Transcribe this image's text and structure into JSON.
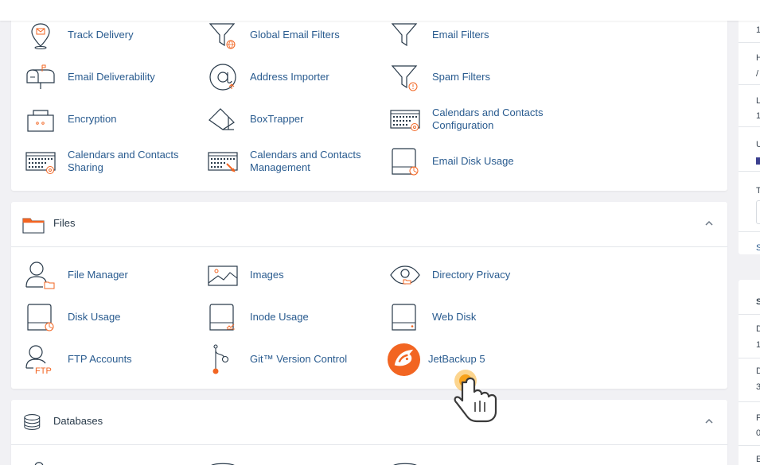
{
  "email_section": {
    "items": [
      {
        "label": "Track Delivery",
        "icon": "track-delivery-icon"
      },
      {
        "label": "Global Email Filters",
        "icon": "global-email-filters-icon"
      },
      {
        "label": "Email Filters",
        "icon": "email-filters-icon"
      },
      {
        "label": "Email Deliverability",
        "icon": "email-deliverability-icon"
      },
      {
        "label": "Address Importer",
        "icon": "address-importer-icon"
      },
      {
        "label": "Spam Filters",
        "icon": "spam-filters-icon"
      },
      {
        "label": "Encryption",
        "icon": "encryption-icon"
      },
      {
        "label": "BoxTrapper",
        "icon": "boxtrapper-icon"
      },
      {
        "label": "Calendars and Contacts Configuration",
        "icon": "calendar-config-icon"
      },
      {
        "label": "Calendars and Contacts Sharing",
        "icon": "calendar-sharing-icon"
      },
      {
        "label": "Calendars and Contacts Management",
        "icon": "calendar-management-icon"
      },
      {
        "label": "Email Disk Usage",
        "icon": "email-disk-usage-icon"
      }
    ]
  },
  "files_section": {
    "title": "Files",
    "items": [
      {
        "label": "File Manager",
        "icon": "file-manager-icon"
      },
      {
        "label": "Images",
        "icon": "images-icon"
      },
      {
        "label": "Directory Privacy",
        "icon": "directory-privacy-icon"
      },
      {
        "label": "Disk Usage",
        "icon": "disk-usage-icon"
      },
      {
        "label": "Inode Usage",
        "icon": "inode-usage-icon"
      },
      {
        "label": "Web Disk",
        "icon": "web-disk-icon"
      },
      {
        "label": "FTP Accounts",
        "icon": "ftp-accounts-icon"
      },
      {
        "label": "Git™ Version Control",
        "icon": "git-icon"
      },
      {
        "label": "JetBackup 5",
        "icon": "jetbackup-icon"
      }
    ],
    "ftp_badge": "FTP"
  },
  "databases_section": {
    "title": "Databases"
  },
  "right_column": {
    "c1_rows": [
      "1",
      "H",
      "/",
      "L",
      "1",
      "U",
      "T",
      "S"
    ],
    "c2_rows": [
      "S",
      "D",
      "1",
      "D",
      "3",
      "F",
      "0",
      "E"
    ]
  },
  "colors": {
    "accent": "#f26522",
    "link": "#295b8f",
    "icon_stroke": "#293a4a"
  }
}
